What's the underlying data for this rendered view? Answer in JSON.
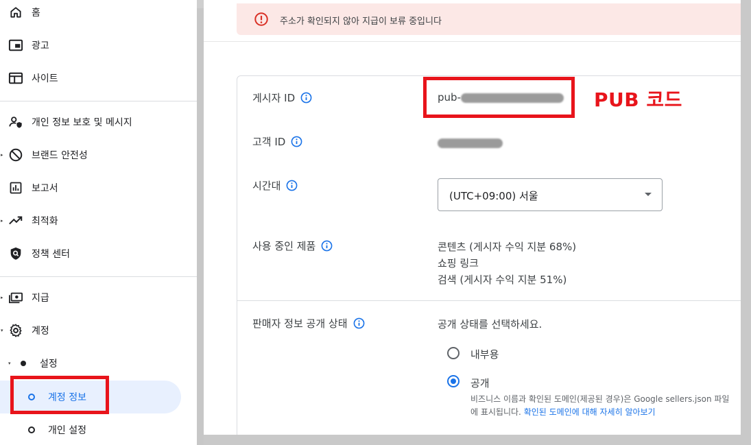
{
  "sidebar": {
    "items": [
      {
        "label": "홈",
        "icon": "home-icon"
      },
      {
        "label": "광고",
        "icon": "ads-icon"
      },
      {
        "label": "사이트",
        "icon": "sites-icon"
      },
      {
        "label": "개인 정보 보호 및 메시지",
        "icon": "privacy-icon"
      },
      {
        "label": "브랜드 안전성",
        "icon": "block-icon"
      },
      {
        "label": "보고서",
        "icon": "bar-chart-icon"
      },
      {
        "label": "최적화",
        "icon": "trending-up-icon"
      },
      {
        "label": "정책 센터",
        "icon": "shield-search-icon"
      },
      {
        "label": "지급",
        "icon": "payments-icon"
      },
      {
        "label": "계정",
        "icon": "gear-icon"
      }
    ],
    "settings_label": "설정",
    "account_info_label": "계정 정보",
    "personal_settings_label": "개인 설정"
  },
  "alert": {
    "text": "주소가 확인되지 않아 지급이 보류 중입니다",
    "color": "#d93025"
  },
  "account": {
    "publisher_id_label": "게시자 ID",
    "publisher_id_prefix": "pub-",
    "customer_id_label": "고객 ID",
    "timezone_label": "시간대",
    "timezone_value": "(UTC+09:00) 서울",
    "products_label": "사용 중인 제품",
    "products": [
      "콘텐츠 (게시자 수익 지분 68%)",
      "쇼핑 링크",
      "검색 (게시자 수익 지분 51%)"
    ],
    "seller_label": "판매자 정보 공개 상태",
    "seller_prompt": "공개 상태를 선택하세요.",
    "option_internal": "내부용",
    "option_public": "공개",
    "public_selected": true,
    "helper_text_1": "비즈니스 이름과 확인된 도메인(제공된 경우)은 Google sellers.json 파일",
    "helper_text_2": "에 표시됩니다.",
    "helper_link": "확인된 도메인에 대해 자세히 알아보기"
  },
  "annotation": {
    "pub_code_label": "PUB 코드",
    "color": "#e8141b"
  },
  "colors": {
    "accent": "#1a73e8",
    "active_bg": "#e8f0fe",
    "alert_bg": "#fce8e6"
  }
}
